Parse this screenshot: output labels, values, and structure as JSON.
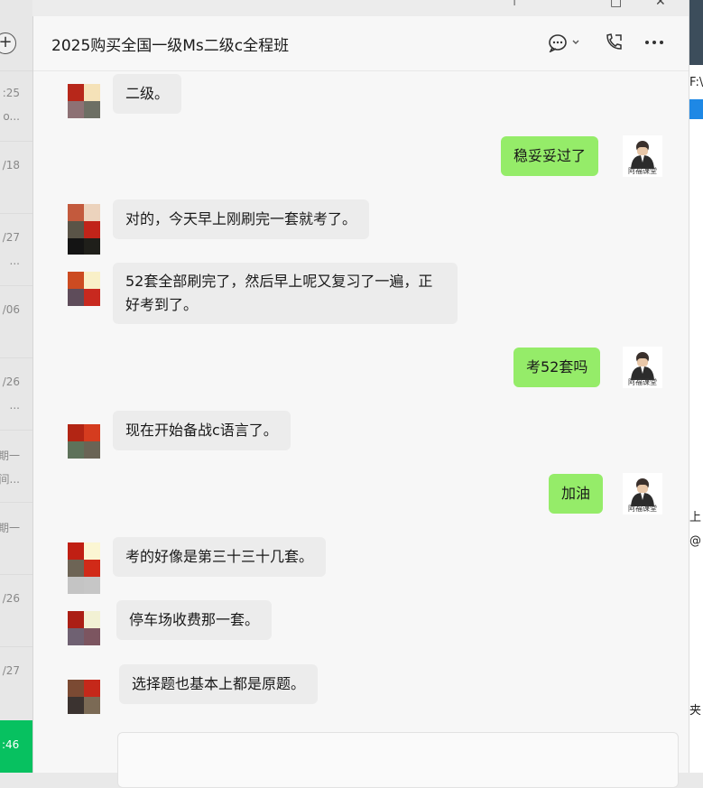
{
  "window": {
    "title": "2025购买全国一级Ms二级c全程班"
  },
  "left_list": {
    "times": [
      ":25",
      "o...",
      "/18",
      "/27",
      "...",
      "/06",
      "/26",
      "...",
      "期一",
      "间...",
      "期一",
      "/26",
      "/27"
    ],
    "active_time": ":46"
  },
  "right_panel": {
    "texts": [
      "F:\\",
      "上",
      "@",
      "夹"
    ]
  },
  "messages": [
    {
      "sender": "other",
      "text": "二级。"
    },
    {
      "sender": "me",
      "text": "稳妥妥过了"
    },
    {
      "sender": "other",
      "text": "对的，今天早上刚刷完一套就考了。"
    },
    {
      "sender": "other",
      "text": "52套全部刷完了，然后早上呢又复习了一遍，正好考到了。"
    },
    {
      "sender": "me",
      "text": "考52套吗"
    },
    {
      "sender": "other",
      "text": "现在开始备战c语言了。"
    },
    {
      "sender": "me",
      "text": "加油"
    },
    {
      "sender": "other",
      "text": "考的好像是第三十三十几套。"
    },
    {
      "sender": "other",
      "text": "停车场收费那一套。"
    },
    {
      "sender": "other",
      "text": "选择题也基本上都是原题。"
    }
  ],
  "avatar_caption": "阿福课堂",
  "icons": {
    "chat_options": "speech-bubble-icon",
    "call": "phone-call-icon",
    "more": "more-dots-icon",
    "add": "plus-circle-icon"
  },
  "colors": {
    "my_bubble": "#95ec69",
    "other_bubble": "#ececec",
    "accent_green": "#07c160"
  }
}
